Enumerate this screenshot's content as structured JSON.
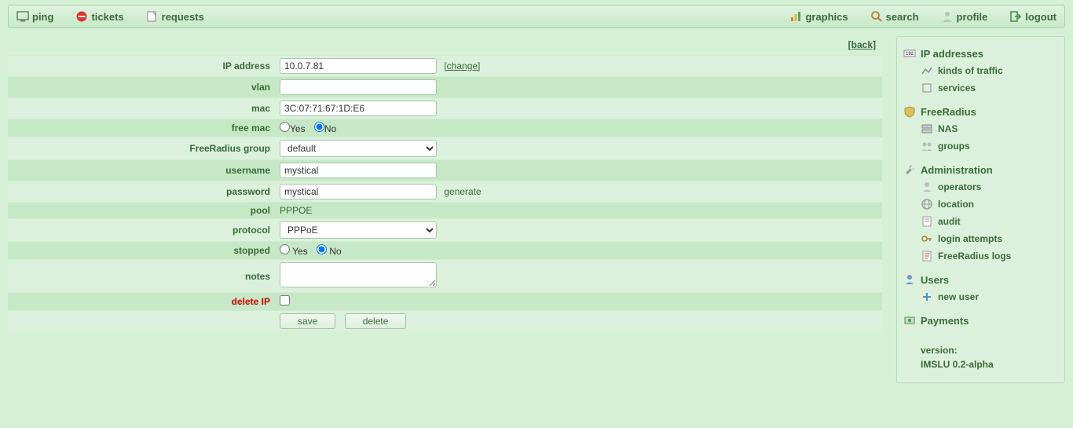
{
  "nav": {
    "left": {
      "ping": "ping",
      "tickets": "tickets",
      "requests": "requests"
    },
    "right": {
      "graphics": "graphics",
      "search": "search",
      "profile": "profile",
      "logout": "logout"
    }
  },
  "back_link": "[back]",
  "form": {
    "labels": {
      "ip_address": "IP address",
      "vlan": "vlan",
      "mac": "mac",
      "free_mac": "free mac",
      "freeradius_group": "FreeRadius group",
      "username": "username",
      "password": "password",
      "pool": "pool",
      "protocol": "protocol",
      "stopped": "stopped",
      "notes": "notes",
      "delete_ip": "delete IP"
    },
    "values": {
      "ip_address": "10.0.7.81",
      "vlan": "",
      "mac": "3C:07:71:67:1D:E6",
      "free_mac": "No",
      "freeradius_group": "default",
      "username": "mystical",
      "password": "mystical",
      "pool": "PPPOE",
      "protocol": "PPPoE",
      "stopped": "No",
      "notes": ""
    },
    "actions": {
      "change": "[change]",
      "generate": "generate",
      "yes": "Yes",
      "no": "No",
      "save": "save",
      "delete": "delete"
    }
  },
  "sidebar": {
    "ip_addresses": "IP addresses",
    "kinds_of_traffic": "kinds of traffic",
    "services": "services",
    "freeradius": "FreeRadius",
    "nas": "NAS",
    "groups": "groups",
    "administration": "Administration",
    "operators": "operators",
    "location": "location",
    "audit": "audit",
    "login_attempts": "login attempts",
    "freeradius_logs": "FreeRadius logs",
    "users": "Users",
    "new_user": "new user",
    "payments": "Payments",
    "version_label": "version:",
    "version_value": "IMSLU 0.2-alpha"
  }
}
